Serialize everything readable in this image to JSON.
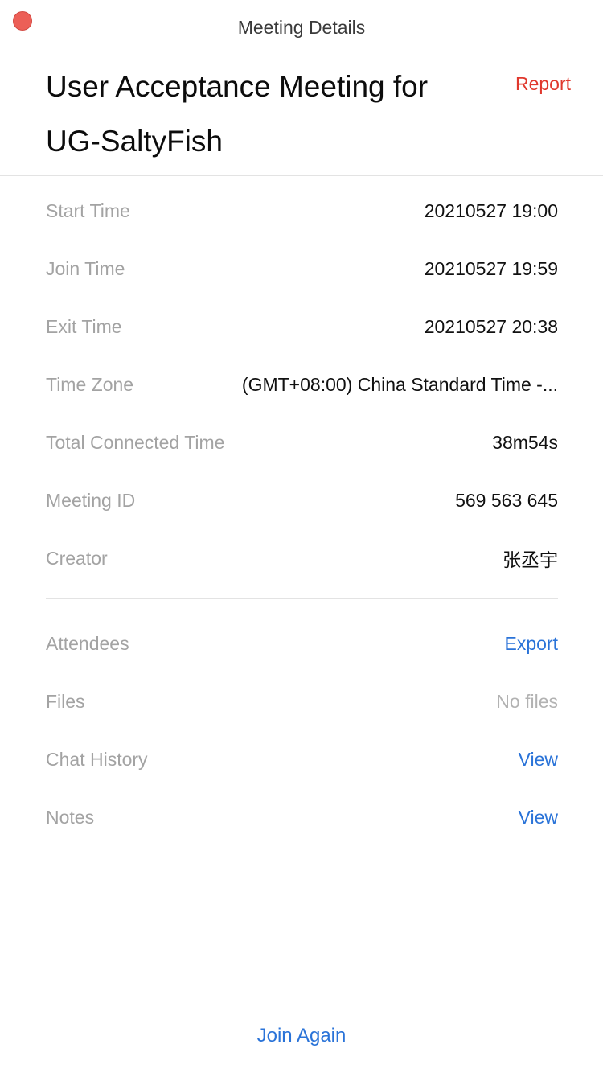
{
  "window": {
    "title": "Meeting Details"
  },
  "header": {
    "meeting_title": "User Acceptance Meeting for UG-SaltyFish",
    "report_label": "Report"
  },
  "details": [
    {
      "label": "Start Time",
      "value": "20210527 19:00"
    },
    {
      "label": "Join Time",
      "value": "20210527 19:59"
    },
    {
      "label": "Exit Time",
      "value": "20210527 20:38"
    },
    {
      "label": "Time Zone",
      "value": "(GMT+08:00) China Standard Time -..."
    },
    {
      "label": "Total Connected Time",
      "value": "38m54s"
    },
    {
      "label": "Meeting ID",
      "value": "569 563 645"
    },
    {
      "label": "Creator",
      "value": "张丞宇"
    }
  ],
  "resources": [
    {
      "label": "Attendees",
      "value": "Export"
    },
    {
      "label": "Files",
      "value": "No files"
    },
    {
      "label": "Chat History",
      "value": "View"
    },
    {
      "label": "Notes",
      "value": "View"
    }
  ],
  "footer": {
    "join_again_label": "Join Again"
  },
  "colors": {
    "close_button": "#ec5f57",
    "report": "#e0382d",
    "link": "#2a73d8",
    "label": "#a3a3a3"
  }
}
